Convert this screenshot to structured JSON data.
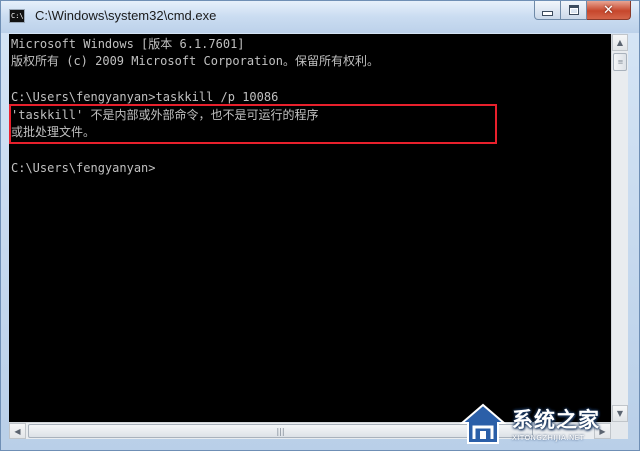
{
  "window": {
    "title": "C:\\Windows\\system32\\cmd.exe",
    "icon_label": "C:\\",
    "buttons": {
      "minimize": "minimize-icon",
      "maximize": "maximize-icon",
      "close": "close-icon"
    }
  },
  "console": {
    "lines": [
      "Microsoft Windows [版本 6.1.7601]",
      "版权所有 (c) 2009 Microsoft Corporation。保留所有权利。",
      "",
      "C:\\Users\\fengyanyan>taskkill /p 10086",
      "'taskkill' 不是内部或外部命令，也不是可运行的程序",
      "或批处理文件。",
      "",
      "C:\\Users\\fengyanyan>"
    ],
    "highlight_color": "#e8202c"
  },
  "scrollbars": {
    "up_arrow": "▲",
    "down_arrow": "▼",
    "left_arrow": "◀",
    "right_arrow": "▶",
    "grip": "≡",
    "hgrip": "|||"
  },
  "watermark": {
    "name": "系统之家",
    "url": "XITONGZHIJIA.NET"
  }
}
